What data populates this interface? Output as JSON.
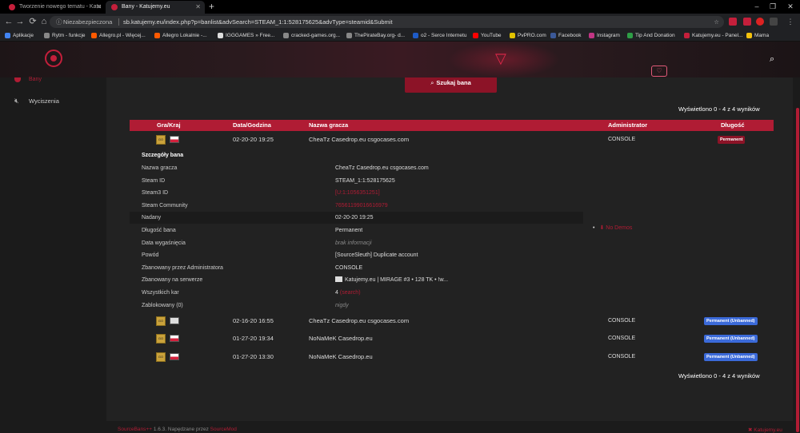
{
  "browser": {
    "tabs": [
      {
        "title": "Tworzenie nowego tematu - Katu",
        "active": false
      },
      {
        "title": "Bany - Katujemy.eu",
        "active": true
      }
    ],
    "new_tab": "+",
    "window_controls": {
      "minimize": "–",
      "maximize": "❐",
      "close": "✕"
    },
    "nav": {
      "back": "←",
      "forward": "→",
      "reload": "⟳",
      "home": "⌂"
    },
    "security_label": "Niezabezpieczona",
    "url": "sb.katujemy.eu/index.php?p=banlist&advSearch=STEAM_1:1:528175625&advType=steamid&Submit",
    "bookmarks": [
      {
        "label": "Aplikacje",
        "color": "#4285f4"
      },
      {
        "label": "Rytm - funkcje",
        "color": "#888888"
      },
      {
        "label": "Allegro.pl - Więcej...",
        "color": "#ff5a00"
      },
      {
        "label": "Allegro Lokalnie -...",
        "color": "#ff5a00"
      },
      {
        "label": "IGGGAMES » Free...",
        "color": "#dddddd"
      },
      {
        "label": "cracked-games.org...",
        "color": "#888888"
      },
      {
        "label": "ThePirateBay.org- d...",
        "color": "#888888"
      },
      {
        "label": "o2 - Serce Internetu",
        "color": "#1e5bc6"
      },
      {
        "label": "YouTube",
        "color": "#ff0000"
      },
      {
        "label": "PvPRO.com",
        "color": "#e0c200"
      },
      {
        "label": "Facebook",
        "color": "#3b5998"
      },
      {
        "label": "Instagram",
        "color": "#c13584"
      },
      {
        "label": "Tip And Donation",
        "color": "#2e9e46"
      },
      {
        "label": "Katujemy.eu - Panel...",
        "color": "#c41f3b"
      },
      {
        "label": "Mama",
        "color": "#f4c20d"
      }
    ]
  },
  "sidebar": {
    "active_label": "Bany",
    "items": [
      {
        "label": "Wyciszenia",
        "icon": "mute-icon"
      }
    ]
  },
  "header": {
    "heart_sign": "♡",
    "search_icon": "⌕"
  },
  "search_button": {
    "icon": "⌕",
    "label": "Szukaj bana"
  },
  "showing_top": "Wyświetlono 0 - 4 z 4 wyników",
  "showing_bottom": "Wyświetlono 0 - 4 z 4 wyników",
  "table": {
    "columns": [
      "Gra/Kraj",
      "Data/Godzina",
      "Nazwa gracza",
      "Administrator",
      "Długość"
    ],
    "rows": [
      {
        "game": "CS:GO",
        "country": "pl",
        "date": "02-20-20 19:25",
        "player": "CheaTz Casedrop.eu csgocases.com",
        "admin": "CONSOLE",
        "length": "Permanent",
        "status": "perm"
      },
      {
        "game": "CS:GO",
        "country": "unknown",
        "date": "02-16-20 16:55",
        "player": "CheaTz Casedrop.eu csgocases.com",
        "admin": "CONSOLE",
        "length": "Permanent (Unbanned)",
        "status": "unbanned"
      },
      {
        "game": "CS:GO",
        "country": "pl",
        "date": "01-27-20 19:34",
        "player": "NoNaMeK Casedrop.eu",
        "admin": "CONSOLE",
        "length": "Permanent (Unbanned)",
        "status": "unbanned"
      },
      {
        "game": "CS:GO",
        "country": "pl",
        "date": "01-27-20 13:30",
        "player": "NoNaMeK Casedrop.eu",
        "admin": "CONSOLE",
        "length": "Permanent (Unbanned)",
        "status": "unbanned"
      }
    ]
  },
  "details": {
    "title": "Szczegóły bana",
    "fields": [
      {
        "key": "Nazwa gracza",
        "value": "CheaTz Casedrop.eu csgocases.com",
        "style": ""
      },
      {
        "key": "Steam ID",
        "value": "STEAM_1:1:528175625",
        "style": ""
      },
      {
        "key": "Steam3 ID",
        "value": "[U:1:1056351251]",
        "style": "red"
      },
      {
        "key": "Steam Community",
        "value": "76561199016616979",
        "style": "red"
      },
      {
        "key": "Nadany",
        "value": "02-20-20 19:25",
        "style": ""
      },
      {
        "key": "Długość bana",
        "value": "Permanent",
        "style": ""
      },
      {
        "key": "Data wygaśnięcia",
        "value": "brak informacji",
        "style": "muted"
      },
      {
        "key": "Powód",
        "value": "[SourceSleuth] Duplicate account",
        "style": ""
      },
      {
        "key": "Zbanowany przez Administratora",
        "value": "CONSOLE",
        "style": ""
      },
      {
        "key": "Zbanowany na serwerze",
        "value": "Katujemy.eu | MIRAGE #3 • 128 TK • !w...",
        "style": "server"
      },
      {
        "key": "Wszystkich kar",
        "value": "4",
        "link": "(search)",
        "style": "count"
      },
      {
        "key": "Zablokowany (0)",
        "value": "nigdy",
        "style": "muted"
      }
    ],
    "no_demos": "No Demos"
  },
  "footer": {
    "left_prefix": "SourceBans++",
    "left_middle": " 1.6.3. Napędzane przez ",
    "left_suffix": "SourceMod",
    "right": "✖ Katujemy.eu"
  },
  "colors": {
    "accent": "#b01c34",
    "accent_dark": "#8c1327",
    "unbanned": "#3b6ad9",
    "bg": "#222222",
    "sidebar": "#1b1b1b"
  }
}
